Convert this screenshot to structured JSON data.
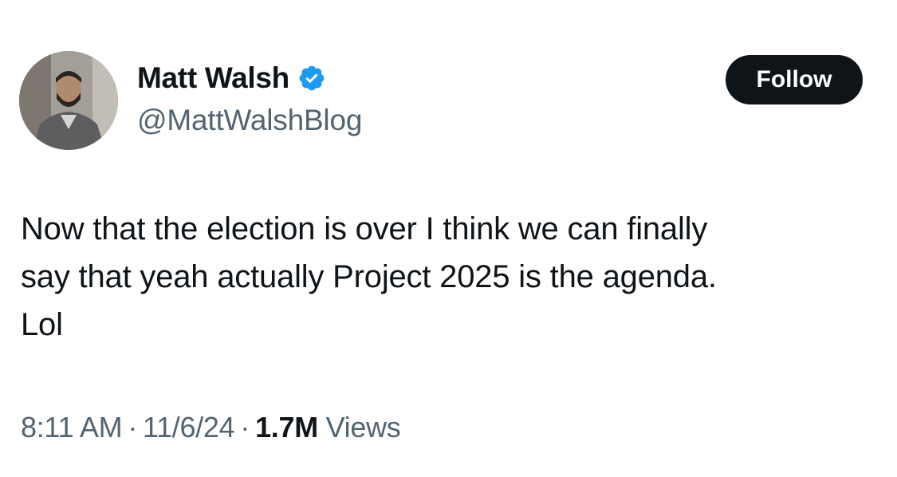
{
  "author": {
    "display_name": "Matt Walsh",
    "handle": "@MattWalshBlog",
    "verified_icon": "verified-badge-icon",
    "verified_color": "#1d9bf0"
  },
  "follow_button": {
    "label": "Follow"
  },
  "tweet": {
    "lines": [
      "Now that the election is over I think we can finally",
      "say that yeah actually Project 2025 is the agenda.",
      "Lol"
    ]
  },
  "meta": {
    "time": "8:11 AM",
    "separator": "·",
    "date": "11/6/24",
    "views_count": "1.7M",
    "views_label": "Views"
  },
  "colors": {
    "text_primary": "#0f1419",
    "text_secondary": "#536471",
    "button_bg": "#0f1419",
    "button_text": "#ffffff"
  }
}
